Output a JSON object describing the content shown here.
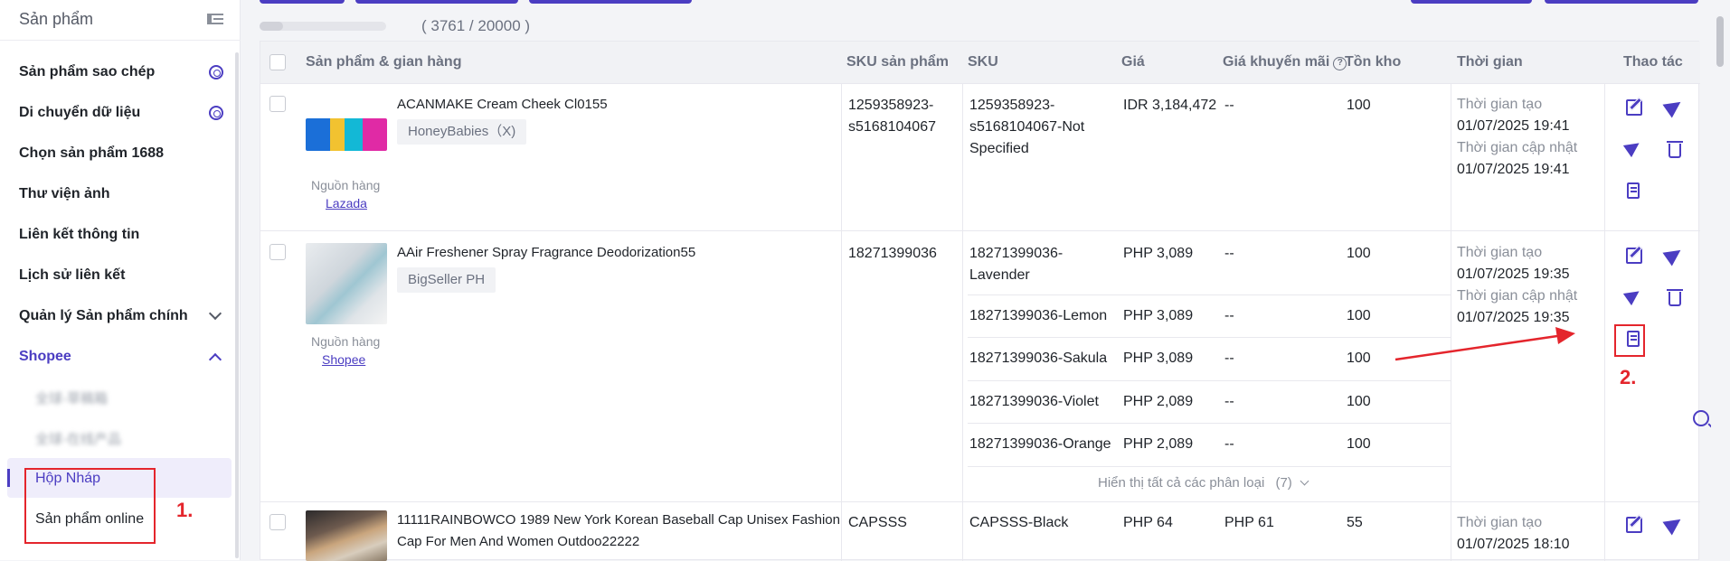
{
  "sidebar": {
    "title": "Sản phẩm",
    "items": [
      {
        "label": "Sản phẩm sao chép"
      },
      {
        "label": "Di chuyển dữ liệu"
      },
      {
        "label": "Chọn sản phẩm 1688"
      },
      {
        "label": "Thư viện ảnh"
      },
      {
        "label": "Liên kết thông tin"
      },
      {
        "label": "Lịch sử liên kết"
      },
      {
        "label": "Quản lý Sản phẩm chính"
      },
      {
        "label": "Shopee"
      }
    ],
    "shopee_sub": [
      {
        "label": "全球-草稿箱"
      },
      {
        "label": "全球-在线产品"
      },
      {
        "label": "Hộp Nháp"
      },
      {
        "label": "Sản phẩm online"
      }
    ]
  },
  "annotations": {
    "step1": "1.",
    "step2": "2."
  },
  "toolbar": {
    "count": "( 3761 / 20000 )",
    "progress": 0.188
  },
  "table": {
    "headers": {
      "product": "Sản phẩm & gian hàng",
      "product_sku": "SKU sản phẩm",
      "sku": "SKU",
      "price": "Giá",
      "promo": "Giá khuyến mãi",
      "stock": "Tồn kho",
      "time": "Thời gian",
      "actions": "Thao tác"
    },
    "rows": [
      {
        "name": "ACANMAKE Cream Cheek Cl0155",
        "store": "HoneyBabies（X)",
        "source_label": "Nguồn hàng",
        "source": "Lazada",
        "product_sku_1": "1259358923-",
        "product_sku_2": "s5168104067",
        "sku_lines": [
          "1259358923-",
          "s5168104067-Not",
          "Specified"
        ],
        "price": "IDR 3,184,472",
        "promo": "--",
        "stock": "100",
        "created_label": "Thời gian tạo",
        "created": "01/07/2025 19:41",
        "updated_label": "Thời gian cập nhật",
        "updated": "01/07/2025 19:41"
      },
      {
        "name": "AAir Freshener Spray Fragrance Deodorization55",
        "store": "BigSeller PH",
        "source_label": "Nguồn hàng",
        "source": "Shopee",
        "product_sku": "18271399036",
        "variants": [
          {
            "sku1": "18271399036-",
            "sku2": "Lavender",
            "price": "PHP 3,089",
            "promo": "--",
            "stock": "100"
          },
          {
            "sku1": "18271399036-Lemon",
            "price": "PHP 3,089",
            "promo": "--",
            "stock": "100"
          },
          {
            "sku1": "18271399036-Sakula",
            "price": "PHP 3,089",
            "promo": "--",
            "stock": "100"
          },
          {
            "sku1": "18271399036-Violet",
            "price": "PHP 2,089",
            "promo": "--",
            "stock": "100"
          },
          {
            "sku1": "18271399036-Orange",
            "price": "PHP 2,089",
            "promo": "--",
            "stock": "100"
          }
        ],
        "show_all": "Hiển thị tất cả các phân loại",
        "show_all_count": "(7)",
        "created_label": "Thời gian tạo",
        "created": "01/07/2025 19:35",
        "updated_label": "Thời gian cập nhật",
        "updated": "01/07/2025 19:35"
      },
      {
        "name_1": "11111RAINBOWCO 1989 New York Korean Baseball Cap Unisex Fashion",
        "name_2": "Cap For Men And Women Outdoo22222",
        "product_sku": "CAPSSS",
        "sku": "CAPSSS-Black",
        "price": "PHP 64",
        "promo": "PHP 61",
        "stock": "55",
        "created_label": "Thời gian tạo",
        "created": "01/07/2025 18:10"
      }
    ]
  },
  "colors": {
    "accent": "#4b3dc2",
    "annotation": "#e4252c"
  }
}
